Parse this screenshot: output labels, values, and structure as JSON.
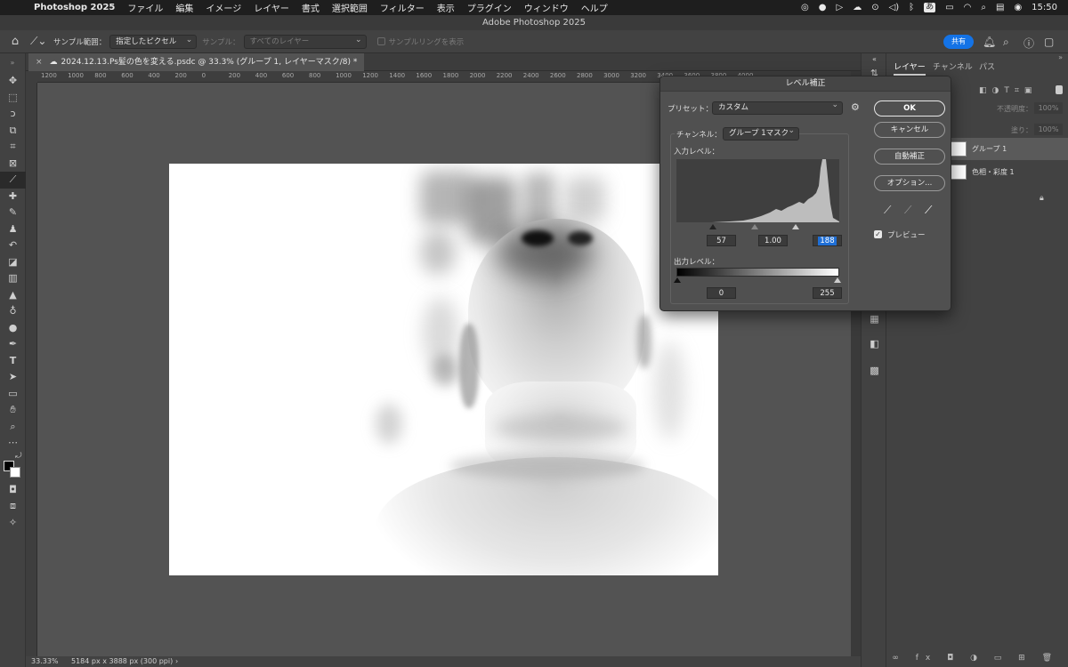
{
  "menubar": {
    "app_name": "Photoshop 2025",
    "menus": [
      "ファイル",
      "編集",
      "イメージ",
      "レイヤー",
      "書式",
      "選択範囲",
      "フィルター",
      "表示",
      "プラグイン",
      "ウィンドウ",
      "ヘルプ"
    ],
    "ime": "あ",
    "clock": "15:50"
  },
  "window": {
    "title": "Adobe Photoshop 2025"
  },
  "options": {
    "sample_size_label": "サンプル範囲：",
    "sample_size_value": "指定したピクセル",
    "sample_label": "サンプル：",
    "sample_value": "すべてのレイヤー",
    "sample_ring_label": "サンプルリングを表示",
    "share_label": "共有"
  },
  "document": {
    "tab_title": "2024.12.13.Ps髪の色を変える.psdc @ 33.3% (グループ 1, レイヤーマスク/8) *",
    "zoom": "33.33%",
    "dimensions": "5184 px x 3888 px (300 ppi)",
    "ruler_ticks": [
      "1200",
      "1000",
      "800",
      "600",
      "400",
      "200",
      "0",
      "200",
      "400",
      "600",
      "800",
      "1000",
      "1200",
      "1400",
      "1600",
      "1800",
      "2000",
      "2200",
      "2400",
      "2600",
      "2800",
      "3000",
      "3200",
      "3400",
      "3600",
      "3800",
      "4000"
    ]
  },
  "layers_panel": {
    "tabs": [
      "レイヤー",
      "チャンネル",
      "パス"
    ],
    "opacity_label": "不透明度：",
    "opacity_value": "100%",
    "fill_label": "塗り：",
    "fill_value": "100%",
    "layers": [
      {
        "name": "グループ 1"
      },
      {
        "name": "色相・彩度 1"
      }
    ]
  },
  "levels_dialog": {
    "title": "レベル補正",
    "preset_label": "プリセット：",
    "preset_value": "カスタム",
    "channel_label": "チャンネル：",
    "channel_value": "グループ 1マスク",
    "input_label": "入力レベル：",
    "input_black": "57",
    "input_gamma": "1.00",
    "input_white": "188",
    "output_label": "出力レベル：",
    "output_black": "0",
    "output_white": "255",
    "ok_label": "OK",
    "cancel_label": "キャンセル",
    "auto_label": "自動補正",
    "options_label": "オプション...",
    "preview_label": "プレビュー",
    "preview_checked": true
  }
}
